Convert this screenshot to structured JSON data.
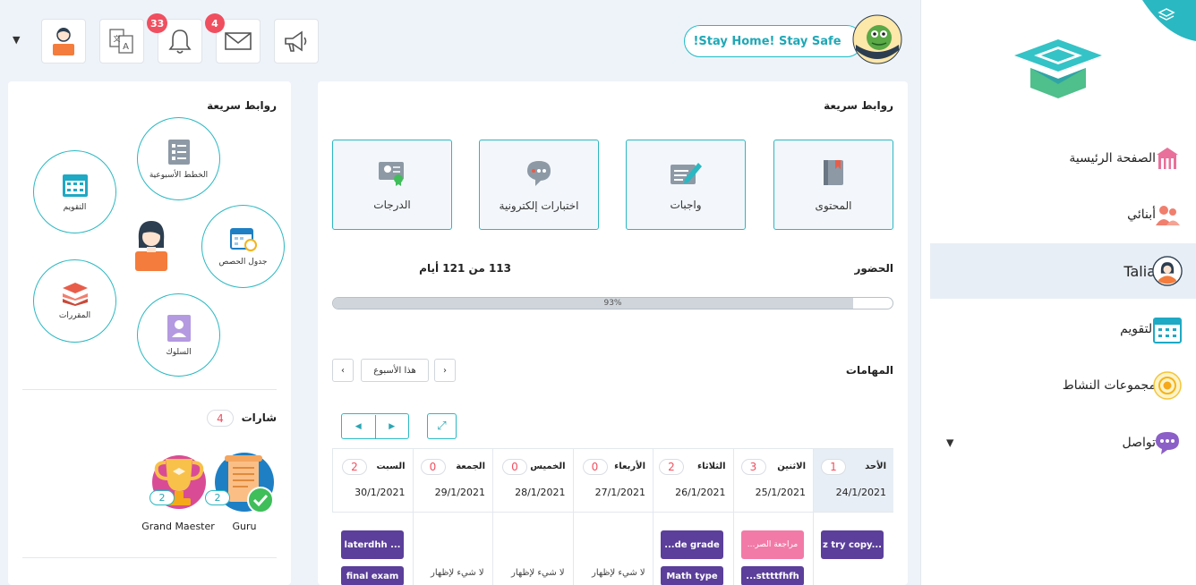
{
  "header": {
    "announcement": "!Stay Home! Stay Safe",
    "notifications_count": "33",
    "messages_count": "4"
  },
  "sidebar": {
    "items": [
      {
        "label": "الصفحة الرئيسية",
        "icon": "school-icon"
      },
      {
        "label": "أبنائي",
        "icon": "children-icon"
      },
      {
        "label": "Talia",
        "icon": "student-avatar-icon"
      },
      {
        "label": "التقويم",
        "icon": "calendar-icon"
      },
      {
        "label": "مجموعات النشاط",
        "icon": "activity-groups-icon"
      },
      {
        "label": "تواصل",
        "icon": "chat-icon"
      }
    ]
  },
  "left_panel": {
    "title": "روابط سريعة",
    "links": [
      {
        "label": "الخطط الأسبوعية",
        "icon": "weekly-plan-icon"
      },
      {
        "label": "التقويم",
        "icon": "calendar-icon"
      },
      {
        "label": "جدول الحصص",
        "icon": "timetable-icon"
      },
      {
        "label": "المقررات",
        "icon": "books-icon"
      },
      {
        "label": "السلوك",
        "icon": "behavior-icon"
      }
    ],
    "badges_title": "شارات",
    "badges_count": "4",
    "badges": [
      {
        "name": "Guru",
        "count": "2",
        "icon": "guru-badge-icon"
      },
      {
        "name": "Grand Maester",
        "count": "2",
        "icon": "trophy-badge-icon"
      }
    ]
  },
  "main_panel": {
    "title": "روابط سريعة",
    "tiles": [
      {
        "label": "المحتوى",
        "icon": "book-icon"
      },
      {
        "label": "واجبات",
        "icon": "homework-icon"
      },
      {
        "label": "اختبارات إلكترونية",
        "icon": "online-exam-icon"
      },
      {
        "label": "الدرجات",
        "icon": "grades-certificate-icon"
      }
    ],
    "attendance_label": "الحضور",
    "attendance_text": "113 من 121 أيام",
    "attendance_percent_label": "93%",
    "attendance_fraction": 0.93,
    "tasks_label": "المهامات",
    "week_label": "هذا الأسبوع",
    "days": [
      {
        "name": "الأحد",
        "count": "1",
        "date": "24/1/2021"
      },
      {
        "name": "الاثنين",
        "count": "3",
        "date": "25/1/2021"
      },
      {
        "name": "الثلاثاء",
        "count": "2",
        "date": "26/1/2021"
      },
      {
        "name": "الأربعاء",
        "count": "0",
        "date": "27/1/2021"
      },
      {
        "name": "الخميس",
        "count": "0",
        "date": "28/1/2021"
      },
      {
        "name": "الجمعة",
        "count": "0",
        "date": "29/1/2021"
      },
      {
        "name": "السبت",
        "count": "2",
        "date": "30/1/2021"
      }
    ],
    "tasks": {
      "sun_1": "z try copy...",
      "mon_1": "...مراجعة الصر",
      "mon_2": "...sttttfhfh",
      "tue_1": "...de grade",
      "tue_2": "Math type",
      "sat_1": "laterdhh ...",
      "sat_2": "final exam"
    },
    "empty_text": "لا شيء لإظهار"
  },
  "colors": {
    "accent": "#2ab8c2",
    "badge_red": "#f04f5f",
    "task_purple": "#5b3f9a",
    "task_pink": "#f27aa6"
  }
}
